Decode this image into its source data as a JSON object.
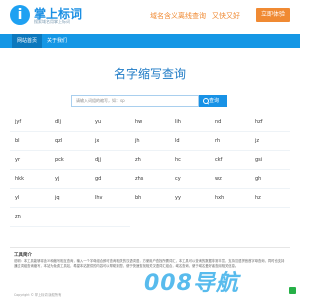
{
  "header": {
    "logo_mark": "i",
    "logo_name": "掌上标词",
    "logo_sub": "搜索域名用掌上标词",
    "slogan_1": "域名含义离线查询",
    "slogan_2": "又快又好",
    "cta": "立即体验"
  },
  "nav": {
    "items": [
      {
        "label": "网站首页"
      },
      {
        "label": "关于我们"
      }
    ]
  },
  "main": {
    "title": "名字缩写查询",
    "search_placeholder": "请输入词组的缩写，如：sp",
    "search_button": "查询"
  },
  "grid": {
    "cells": [
      "jyf",
      "dlj",
      "yu",
      "hw",
      "lih",
      "nd",
      "hzf",
      "bl",
      "qzl",
      "jx",
      "jh",
      "ld",
      "rh",
      "jz",
      "yr",
      "pck",
      "djj",
      "zh",
      "hc",
      "ckf",
      "gsi",
      "hkk",
      "yj",
      "gd",
      "zhs",
      "cy",
      "wz",
      "gh",
      "yl",
      "jq",
      "lhv",
      "bh",
      "yy",
      "hxh",
      "hz",
      "zn",
      "",
      ""
    ]
  },
  "intro": {
    "title": "工具简介",
    "text": "说明：本工具能够将含义和缩写相互查询，输入一个字母组合即可查询相关的汉语词语，方便用户查找所需词汇，本工具可以查询的数据非常丰富，支持汉语拼音首字母查询，同时也支持通过词组查询缩写，本站为免费工具站，希望本站提供的内容可以帮助到您，便于快速查找相关汉语词汇组合，域名查询，便于域名爱好者查阅相关信息。",
    "footer": "Copyright © 掌上标词 版权所有"
  },
  "watermark": "008导航",
  "colors": {
    "brand_blue": "#1597e5",
    "accent_orange": "#f08a33",
    "watermark_blue": "#3bb0ea"
  }
}
